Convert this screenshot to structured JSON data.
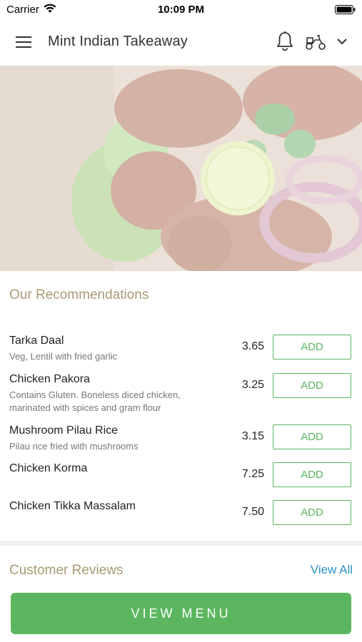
{
  "status_bar": {
    "carrier": "Carrier",
    "time": "10:09 PM"
  },
  "header": {
    "title": "Mint Indian Takeaway"
  },
  "recommendations": {
    "title": "Our Recommendations",
    "add_label": "ADD",
    "items": [
      {
        "name": "Tarka Daal",
        "description": "Veg, Lentil with fried garlic",
        "price": "3.65"
      },
      {
        "name": "Chicken Pakora",
        "description": "Contains Gluten. Boneless diced chicken, marinated with spices and gram flour",
        "price": "3.25"
      },
      {
        "name": "Mushroom Pilau Rice",
        "description": "Pilau rice fried with mushrooms",
        "price": "3.15"
      },
      {
        "name": "Chicken Korma",
        "description": "",
        "price": "7.25"
      },
      {
        "name": "Chicken Tikka Massalam",
        "description": "",
        "price": "7.50"
      }
    ]
  },
  "reviews": {
    "title": "Customer Reviews",
    "view_all": "View All"
  },
  "footer": {
    "view_menu": "VIEW MENU"
  },
  "colors": {
    "accent_green": "#5cb65f",
    "link_blue": "#2b8fc6",
    "section_title": "#a89a72"
  }
}
